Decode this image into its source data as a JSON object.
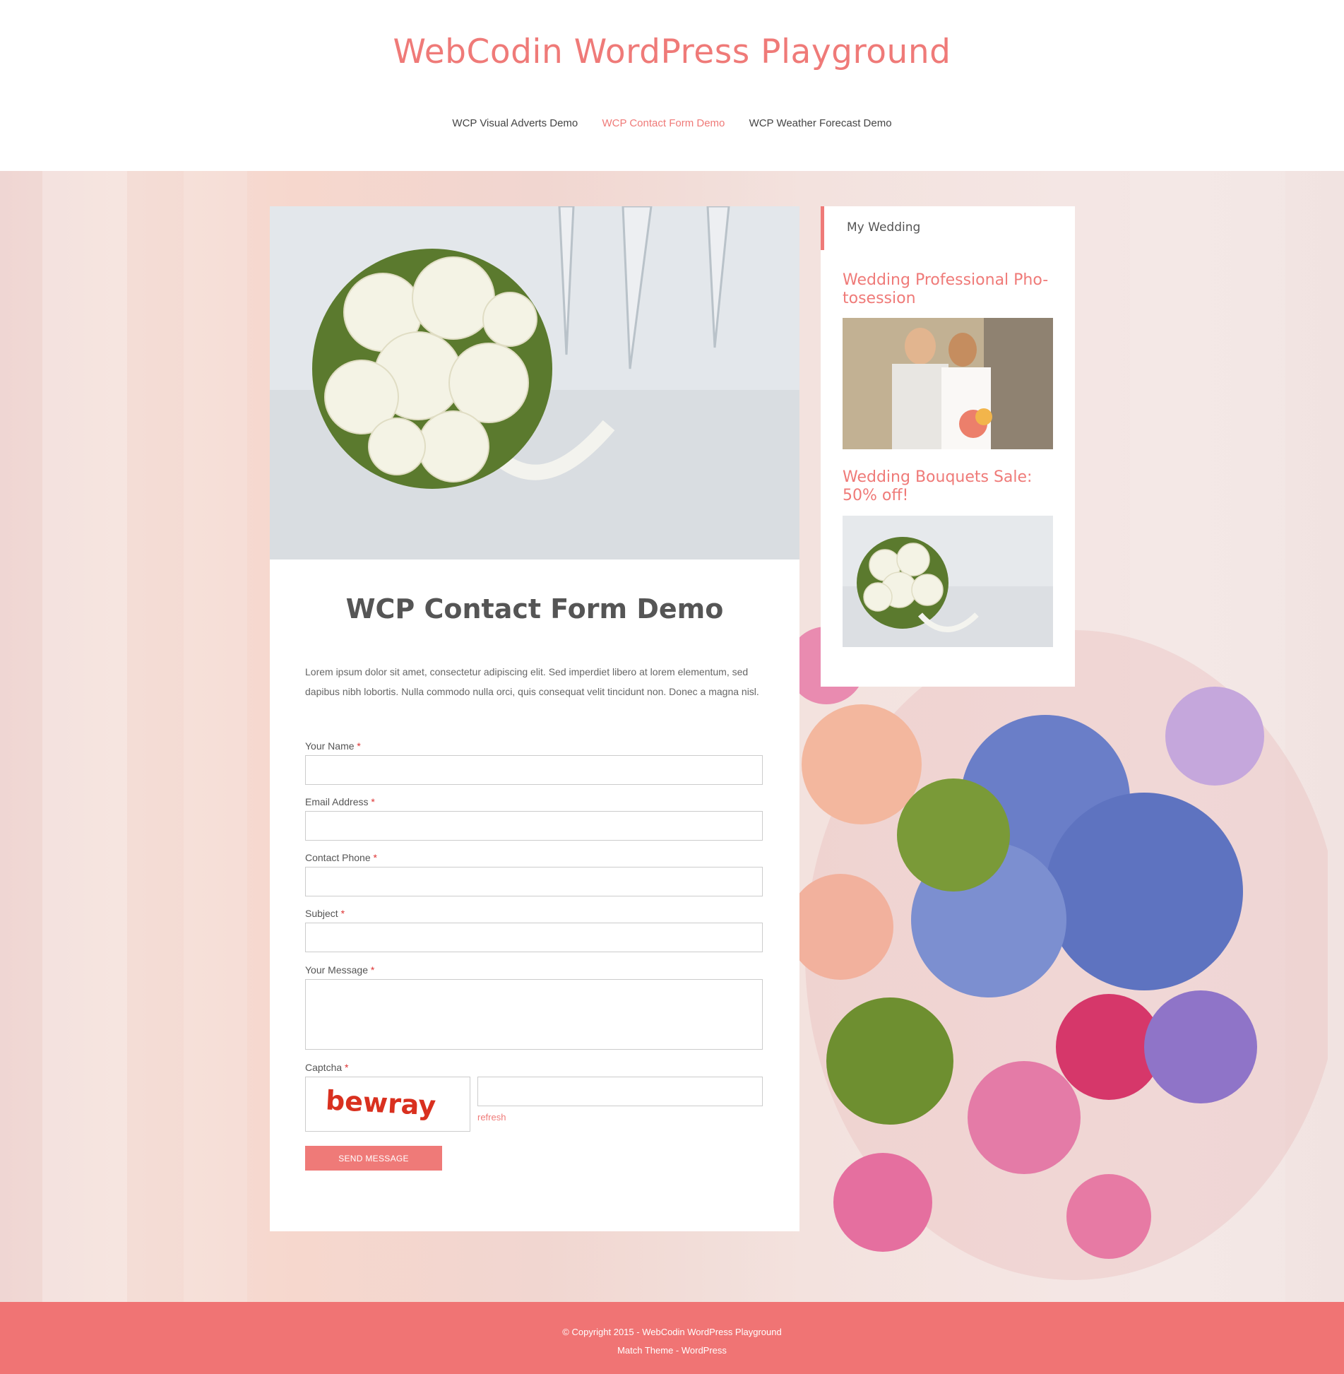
{
  "site": {
    "title": "WebCodin WordPress Playground"
  },
  "nav": {
    "items": [
      {
        "label": "WCP Visual Adverts Demo"
      },
      {
        "label": "WCP Contact Form Demo"
      },
      {
        "label": "WCP Weather Forecast Demo"
      }
    ],
    "active_index": 1
  },
  "post": {
    "title": "WCP Contact Form Demo",
    "intro": "Lorem ipsum dolor sit amet, consectetur adipiscing elit. Sed imperdiet libero at lorem elementum, sed dapibus nibh lobortis. Nulla commodo nulla orci, quis consequat velit tincidunt non. Donec a magna nisl."
  },
  "form": {
    "required_marker": "*",
    "fields": [
      {
        "label": "Your Name",
        "value": ""
      },
      {
        "label": "Email Address",
        "value": ""
      },
      {
        "label": "Contact Phone",
        "value": ""
      },
      {
        "label": "Subject",
        "value": ""
      },
      {
        "label": "Your Message",
        "value": ""
      }
    ],
    "captcha": {
      "label": "Captcha",
      "image_text": "bewray",
      "value": "",
      "refresh_label": "refresh"
    },
    "submit_label": "SEND MESSAGE"
  },
  "sidebar": {
    "widget_title": "My Wedding",
    "ads": [
      {
        "title": "Wedding Professional Pho-tosession",
        "image": "wedding-couple-photo"
      },
      {
        "title": "Wedding Bouquets Sale: 50% off!",
        "image": "white-rose-bouquet-photo"
      }
    ]
  },
  "footer": {
    "line1": "© Copyright 2015 - WebCodin WordPress Playground",
    "line2": "Match Theme - WordPress"
  },
  "colors": {
    "accent": "#ef7a78",
    "footer_bg": "#f07474"
  }
}
